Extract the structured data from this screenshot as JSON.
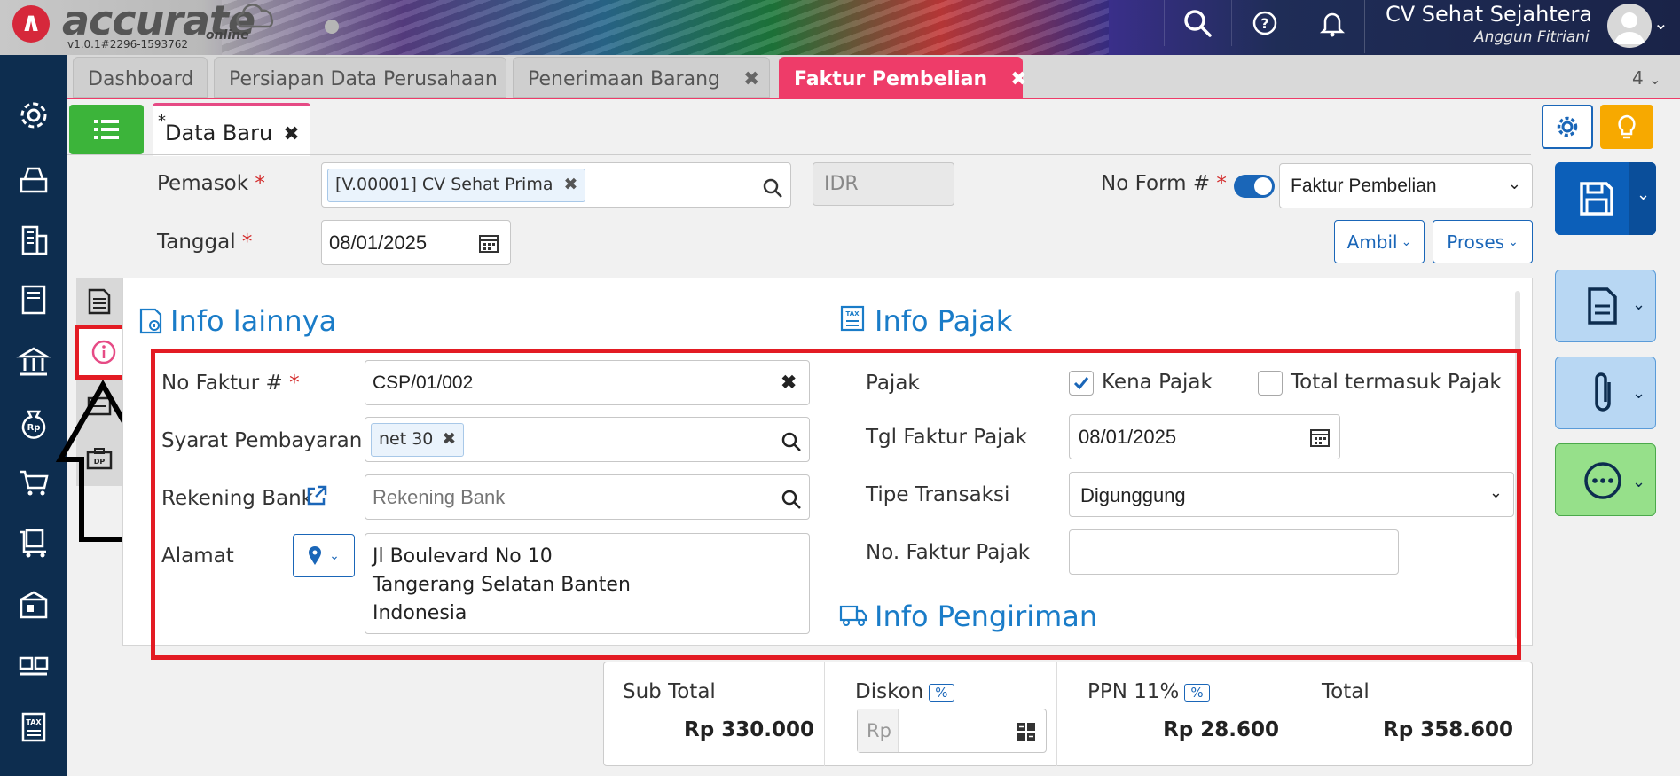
{
  "app": {
    "name": "accurate",
    "subname": "online",
    "version": "v1.0.1#2296-1593762"
  },
  "header": {
    "company": "CV Sehat Sejahtera",
    "user": "Anggun Fitriani"
  },
  "tabs": [
    {
      "label": "Dashboard"
    },
    {
      "label": "Persiapan Data Perusahaan"
    },
    {
      "label": "Penerimaan Barang"
    },
    {
      "label": "Faktur Pembelian"
    }
  ],
  "tab_count": "4",
  "subtab": {
    "star": "*",
    "label": "Data Baru"
  },
  "form": {
    "pemasok_label": "Pemasok",
    "pemasok_value": "[V.00001] CV Sehat Prima",
    "currency": "IDR",
    "noform_label": "No Form #",
    "noform_value": "Faktur Pembelian",
    "tanggal_label": "Tanggal",
    "tanggal_value": "08/01/2025",
    "ambil_label": "Ambil",
    "proses_label": "Proses"
  },
  "info_lainnya": {
    "title": "Info lainnya",
    "no_faktur_label": "No Faktur #",
    "no_faktur_value": "CSP/01/002",
    "syarat_label": "Syarat Pembayaran",
    "syarat_value": "net 30",
    "rekening_label": "Rekening Bank",
    "rekening_placeholder": "Rekening Bank",
    "alamat_label": "Alamat",
    "alamat_lines": [
      "Jl Boulevard No 10",
      "Tangerang Selatan Banten",
      "Indonesia"
    ]
  },
  "info_pajak": {
    "title": "Info Pajak",
    "pajak_label": "Pajak",
    "kena_pajak_label": "Kena Pajak",
    "kena_pajak_checked": true,
    "total_termasuk_label": "Total termasuk Pajak",
    "total_termasuk_checked": false,
    "tgl_faktur_label": "Tgl Faktur Pajak",
    "tgl_faktur_value": "08/01/2025",
    "tipe_label": "Tipe Transaksi",
    "tipe_value": "Digunggung",
    "no_faktur_pajak_label": "No. Faktur Pajak",
    "no_faktur_pajak_value": ""
  },
  "info_pengiriman": {
    "title": "Info Pengiriman"
  },
  "summary": {
    "subtotal_label": "Sub Total",
    "subtotal_value": "Rp 330.000",
    "diskon_label": "Diskon",
    "diskon_badge": "%",
    "diskon_placeholder": "Rp",
    "ppn_label": "PPN 11%",
    "ppn_badge": "%",
    "ppn_value": "Rp 28.600",
    "total_label": "Total",
    "total_value": "Rp 358.600"
  },
  "colors": {
    "accent": "#1a66b8",
    "active_tab": "#ee3c69",
    "highlight": "#e31b23",
    "sidebar": "#0d2d4f"
  }
}
